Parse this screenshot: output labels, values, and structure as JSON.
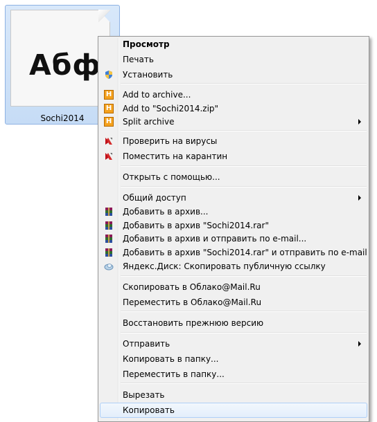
{
  "file": {
    "name": "Sochi2014",
    "preview_text": "Абф"
  },
  "menu": {
    "items": [
      {
        "label": "Просмотр",
        "bold": true,
        "icon": "",
        "submenu": false
      },
      {
        "label": "Печать",
        "icon": "",
        "submenu": false
      },
      {
        "label": "Установить",
        "icon": "uac-shield-icon",
        "submenu": false
      },
      {
        "label": "Add to archive...",
        "icon": "haozip-icon",
        "submenu": false
      },
      {
        "label": "Add to \"Sochi2014.zip\"",
        "icon": "haozip-icon",
        "submenu": false
      },
      {
        "label": "Split archive",
        "icon": "haozip-icon",
        "submenu": true
      },
      {
        "label": "Проверить на вирусы",
        "icon": "kaspersky-icon",
        "submenu": false
      },
      {
        "label": "Поместить на карантин",
        "icon": "kaspersky-icon",
        "submenu": false
      },
      {
        "label": "Открыть с помощью...",
        "icon": "",
        "submenu": false
      },
      {
        "label": "Общий доступ",
        "icon": "",
        "submenu": true
      },
      {
        "label": "Добавить в архив...",
        "icon": "winrar-icon",
        "submenu": false
      },
      {
        "label": "Добавить в архив \"Sochi2014.rar\"",
        "icon": "winrar-icon",
        "submenu": false
      },
      {
        "label": "Добавить в архив и отправить по e-mail...",
        "icon": "winrar-icon",
        "submenu": false
      },
      {
        "label": "Добавить в архив \"Sochi2014.rar\" и отправить по e-mail",
        "icon": "winrar-icon",
        "submenu": false
      },
      {
        "label": "Яндекс.Диск: Скопировать публичную ссылку",
        "icon": "yandex-disk-icon",
        "submenu": false
      },
      {
        "label": "Скопировать в Облако@Mail.Ru",
        "icon": "",
        "submenu": false
      },
      {
        "label": "Переместить в Облако@Mail.Ru",
        "icon": "",
        "submenu": false
      },
      {
        "label": "Восстановить прежнюю версию",
        "icon": "",
        "submenu": false
      },
      {
        "label": "Отправить",
        "icon": "",
        "submenu": true
      },
      {
        "label": "Копировать в папку...",
        "icon": "",
        "submenu": false
      },
      {
        "label": "Переместить в папку...",
        "icon": "",
        "submenu": false
      },
      {
        "label": "Вырезать",
        "icon": "",
        "submenu": false
      },
      {
        "label": "Копировать",
        "icon": "",
        "submenu": false,
        "highlighted": true
      }
    ]
  },
  "colors": {
    "menu_background": "#f0f0f0",
    "selection_background": "#c6dcf6",
    "haozip_orange": "#f4a11d"
  }
}
